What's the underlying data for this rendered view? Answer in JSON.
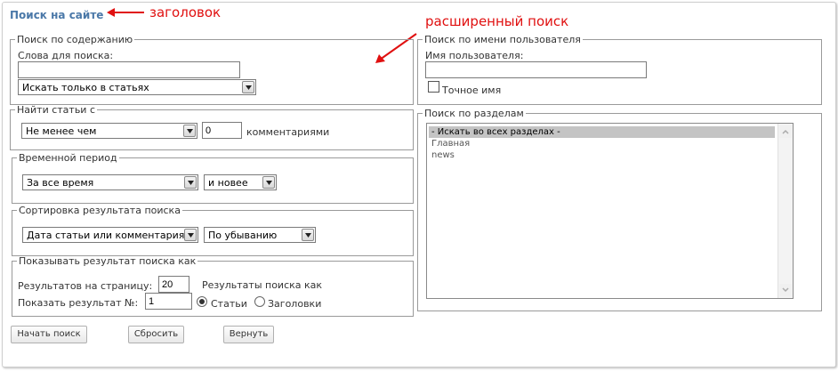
{
  "page": {
    "title": "Поиск на сайте"
  },
  "annotations": {
    "title_note": "заголовок",
    "advanced_note": "расширенный поиск"
  },
  "content_search": {
    "legend": "Поиск по содержанию",
    "keywords_label": "Слова для поиска:",
    "keywords_value": "",
    "scope_selected": "Искать только в статьях"
  },
  "user_search": {
    "legend": "Поиск по имени пользователя",
    "username_label": "Имя пользователя:",
    "username_value": "",
    "exact_name_label": "Точное имя",
    "exact_name_checked": false
  },
  "comments_filter": {
    "legend": "Найти статьи с",
    "comparator_selected": "Не менее чем",
    "count_value": "0",
    "suffix": "комментариями"
  },
  "sections": {
    "legend": "Поиск по разделам",
    "items": [
      "- Искать во всех разделах -",
      "Главная",
      "news"
    ],
    "selected_index": 0
  },
  "period": {
    "legend": "Временной период",
    "range_selected": "За все время",
    "direction_selected": "и новее"
  },
  "sorting": {
    "legend": "Сортировка результата поиска",
    "field_selected": "Дата статьи или комментария",
    "order_selected": "По убыванию"
  },
  "results": {
    "legend": "Показывать результат поиска как",
    "per_page_label": "Результатов на страницу:",
    "per_page_value": "20",
    "display_as_label": "Результаты поиска как",
    "start_label": "Показать результат №:",
    "start_value": "1",
    "option_articles": "Статьи",
    "option_headers": "Заголовки",
    "selected_option": "articles"
  },
  "buttons": {
    "search": "Начать поиск",
    "reset": "Сбросить",
    "back": "Вернуть"
  }
}
